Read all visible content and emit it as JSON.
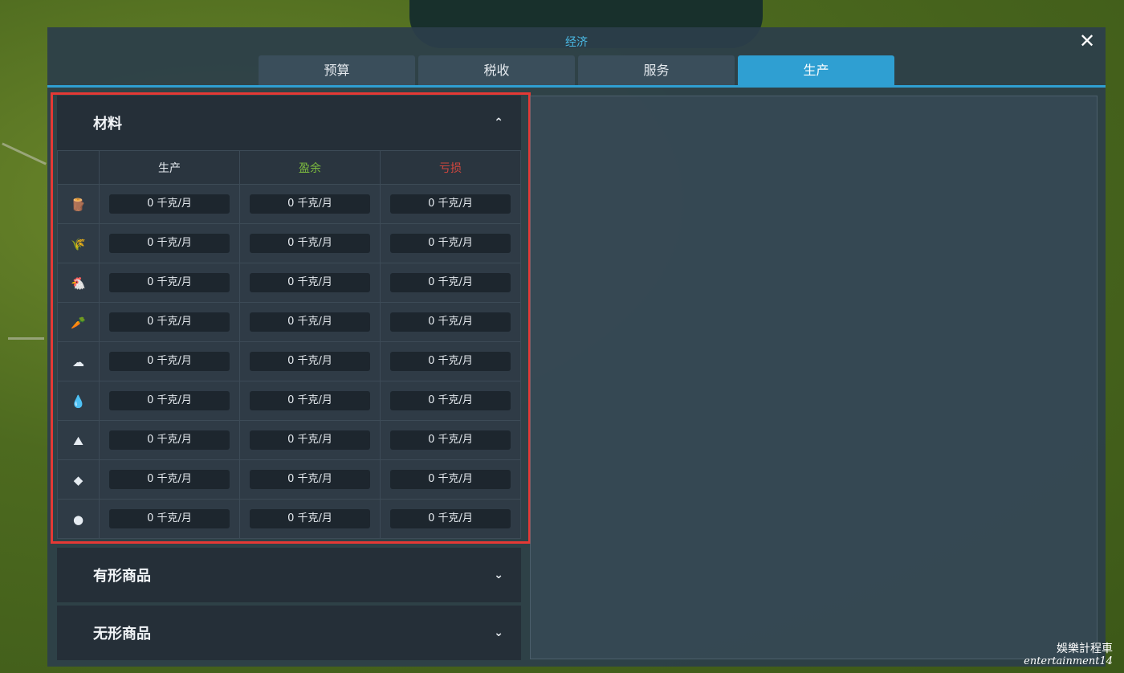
{
  "window": {
    "title": "经济",
    "close_symbol": "✕"
  },
  "tabs": [
    {
      "label": "预算",
      "active": false
    },
    {
      "label": "税收",
      "active": false
    },
    {
      "label": "服务",
      "active": false
    },
    {
      "label": "生产",
      "active": true
    }
  ],
  "sections": {
    "materials": {
      "title": "材料",
      "expanded": true,
      "columns": [
        "生产",
        "盈余",
        "亏损"
      ],
      "rows": [
        {
          "icon": "wood-log-icon",
          "glyph": "🪵",
          "production": "0 千克/月",
          "surplus": "0 千克/月",
          "loss": "0 千克/月"
        },
        {
          "icon": "grain-icon",
          "glyph": "🌾",
          "production": "0 千克/月",
          "surplus": "0 千克/月",
          "loss": "0 千克/月"
        },
        {
          "icon": "chicken-icon",
          "glyph": "🐔",
          "production": "0 千克/月",
          "surplus": "0 千克/月",
          "loss": "0 千克/月"
        },
        {
          "icon": "carrot-icon",
          "glyph": "🥕",
          "production": "0 千克/月",
          "surplus": "0 千克/月",
          "loss": "0 千克/月"
        },
        {
          "icon": "cotton-icon",
          "glyph": "☁",
          "production": "0 千克/月",
          "surplus": "0 千克/月",
          "loss": "0 千克/月"
        },
        {
          "icon": "oil-drop-icon",
          "glyph": "💧",
          "production": "0 千克/月",
          "surplus": "0 千克/月",
          "loss": "0 千克/月"
        },
        {
          "icon": "ore-icon",
          "glyph": "⛰",
          "production": "0 千克/月",
          "surplus": "0 千克/月",
          "loss": "0 千克/月"
        },
        {
          "icon": "coal-icon",
          "glyph": "◆",
          "production": "0 千克/月",
          "surplus": "0 千克/月",
          "loss": "0 千克/月"
        },
        {
          "icon": "stone-icon",
          "glyph": "●",
          "production": "0 千克/月",
          "surplus": "0 千克/月",
          "loss": "0 千克/月"
        }
      ]
    },
    "tangible_goods": {
      "title": "有形商品",
      "expanded": false
    },
    "intangible_goods": {
      "title": "无形商品",
      "expanded": false
    }
  },
  "chevrons": {
    "up": "⌃",
    "down": "⌄"
  },
  "watermark": {
    "line1": "娛樂計程車",
    "line2": "entertainment14"
  },
  "colors": {
    "accent": "#2f9fd2",
    "surplus": "#7dbb3f",
    "loss": "#d0463e",
    "highlight": "#e53935"
  }
}
